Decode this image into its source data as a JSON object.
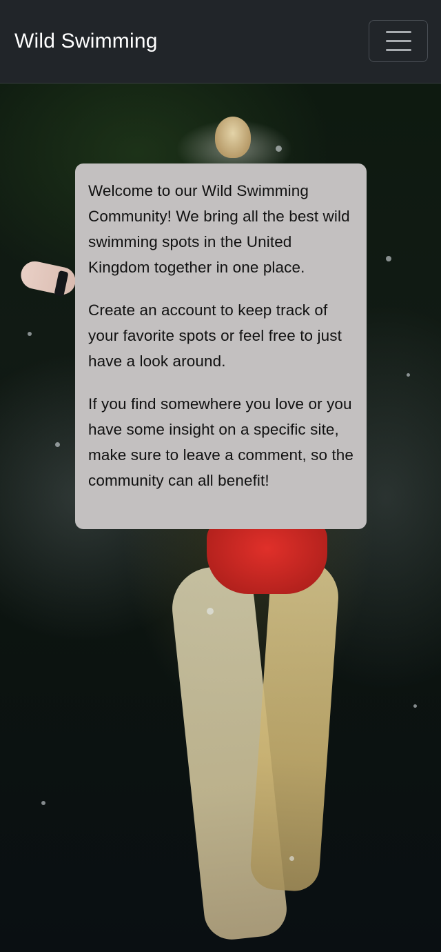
{
  "navbar": {
    "brand": "Wild Swimming",
    "toggler_icon": "hamburger-menu-icon"
  },
  "hero": {
    "image": "swimmer-in-river-photo"
  },
  "welcome": {
    "paragraphs": [
      "Welcome to our Wild Swimming Community! We bring all the best wild swimming spots in the United Kingdom together in one place.",
      "Create an account to keep track of your favorite spots or feel free to just have a look around.",
      "If you find somewhere you love or you have some insight on a specific site, make sure to leave a comment, so the community can all benefit!"
    ]
  },
  "colors": {
    "navbar_bg": "#212529",
    "card_bg": "#c3c0c0",
    "brand_text": "#ffffff"
  }
}
